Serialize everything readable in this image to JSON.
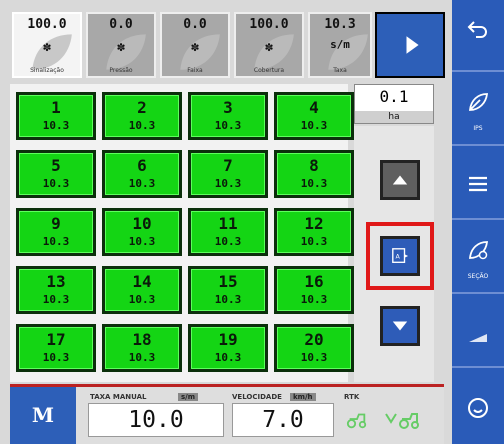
{
  "top_tiles": [
    {
      "value": "100.0",
      "unit": "",
      "label": "Sinalização"
    },
    {
      "value": "0.0",
      "unit": "",
      "label": "Pressão"
    },
    {
      "value": "0.0",
      "unit": "",
      "label": "Faixa"
    },
    {
      "value": "100.0",
      "unit": "",
      "label": "Cobertura"
    },
    {
      "value": "10.3",
      "unit": "s/m",
      "label": "Taxa"
    }
  ],
  "sections": [
    {
      "num": "1",
      "rate": "10.3"
    },
    {
      "num": "2",
      "rate": "10.3"
    },
    {
      "num": "3",
      "rate": "10.3"
    },
    {
      "num": "4",
      "rate": "10.3"
    },
    {
      "num": "5",
      "rate": "10.3"
    },
    {
      "num": "6",
      "rate": "10.3"
    },
    {
      "num": "7",
      "rate": "10.3"
    },
    {
      "num": "8",
      "rate": "10.3"
    },
    {
      "num": "9",
      "rate": "10.3"
    },
    {
      "num": "10",
      "rate": "10.3"
    },
    {
      "num": "11",
      "rate": "10.3"
    },
    {
      "num": "12",
      "rate": "10.3"
    },
    {
      "num": "13",
      "rate": "10.3"
    },
    {
      "num": "14",
      "rate": "10.3"
    },
    {
      "num": "15",
      "rate": "10.3"
    },
    {
      "num": "16",
      "rate": "10.3"
    },
    {
      "num": "17",
      "rate": "10.3"
    },
    {
      "num": "18",
      "rate": "10.3"
    },
    {
      "num": "19",
      "rate": "10.3"
    },
    {
      "num": "20",
      "rate": "10.3"
    }
  ],
  "area": {
    "value": "0.1",
    "unit": "ha"
  },
  "bottom": {
    "mode_label": "M",
    "manual_rate_label": "TAXA MANUAL",
    "manual_rate_unit": "s/m",
    "manual_rate_value": "10.0",
    "speed_label": "VELOCIDADE",
    "speed_unit": "km/h",
    "speed_value": "7.0",
    "rtk_label": "RTK"
  },
  "sidebar": {
    "ips_label": "IPS",
    "section_label": "SEÇÃO"
  },
  "colors": {
    "section_green": "#14d514",
    "accent_blue": "#2d5fb8",
    "highlight_red": "#e01818"
  }
}
